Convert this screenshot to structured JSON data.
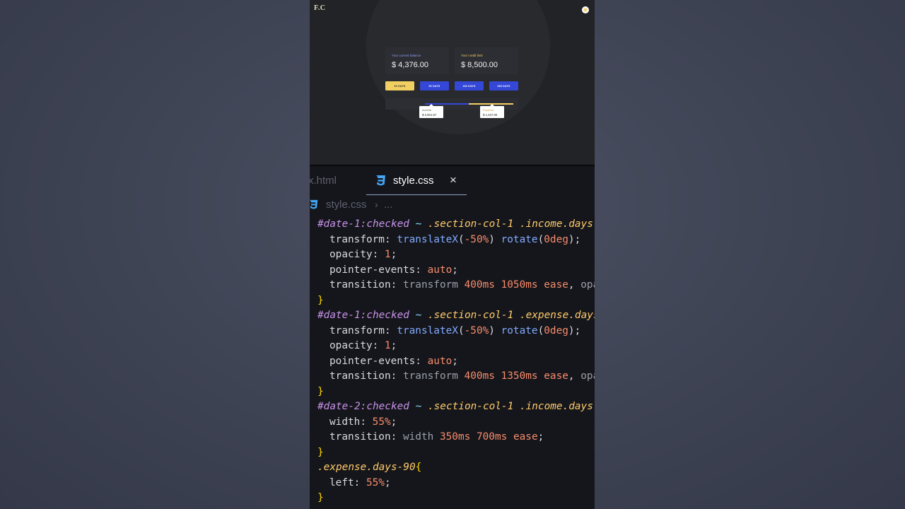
{
  "preview": {
    "logo": "F.C",
    "cards": {
      "balance": {
        "label": "Your current balance",
        "value": "$ 4,376.00"
      },
      "credit": {
        "label": "Your credit limit",
        "value": "$ 8,500.00"
      }
    },
    "range_buttons": [
      "30 DAYS",
      "90 DAYS",
      "180 DAYS",
      "365 DAYS"
    ],
    "selected_range": "30 DAYS",
    "tooltips": {
      "income": {
        "label": "Income",
        "value": "$ 2,501.57"
      },
      "expense": {
        "label": "Expense",
        "value": "$ 1,347.00"
      }
    },
    "colors": {
      "accent_yellow": "#f2cf61",
      "accent_blue": "#3447d6"
    }
  },
  "editor": {
    "tabs": {
      "inactive": "x.html",
      "active": "style.css",
      "close": "×"
    },
    "breadcrumb": {
      "file": "style.css",
      "separator": "›",
      "more": "..."
    },
    "icons": {
      "tab_file": "css3-icon",
      "breadcrumb_file": "css3-icon"
    },
    "code_lines": [
      [
        [
          "sel-id",
          "#date-1"
        ],
        [
          "pseudo",
          ":checked"
        ],
        [
          "comb",
          " ~ "
        ],
        [
          "cls",
          ".section-col-1"
        ],
        [
          "comb",
          " "
        ],
        [
          "cls",
          ".income.days-"
        ]
      ],
      [
        [
          "ind",
          ""
        ],
        [
          "prop",
          "transform"
        ],
        [
          "punc",
          ": "
        ],
        [
          "fn",
          "translateX"
        ],
        [
          "punc",
          "("
        ],
        [
          "num",
          "-50%"
        ],
        [
          "punc",
          ") "
        ],
        [
          "fn",
          "rotate"
        ],
        [
          "punc",
          "("
        ],
        [
          "num",
          "0deg"
        ],
        [
          "punc",
          ");"
        ]
      ],
      [
        [
          "ind",
          ""
        ],
        [
          "prop",
          "opacity"
        ],
        [
          "punc",
          ": "
        ],
        [
          "num",
          "1"
        ],
        [
          "punc",
          ";"
        ]
      ],
      [
        [
          "ind",
          ""
        ],
        [
          "prop",
          "pointer-events"
        ],
        [
          "punc",
          ": "
        ],
        [
          "kw",
          "auto"
        ],
        [
          "punc",
          ";"
        ]
      ],
      [
        [
          "ind",
          ""
        ],
        [
          "prop",
          "transition"
        ],
        [
          "punc",
          ": "
        ],
        [
          "ident",
          "transform "
        ],
        [
          "num",
          "400ms"
        ],
        [
          "punc",
          " "
        ],
        [
          "num",
          "1050ms"
        ],
        [
          "punc",
          " "
        ],
        [
          "kw",
          "ease"
        ],
        [
          "punc",
          ", "
        ],
        [
          "ident",
          "opa"
        ]
      ],
      [
        [
          "brace",
          "}"
        ]
      ],
      [
        [
          "sel-id",
          "#date-1"
        ],
        [
          "pseudo",
          ":checked"
        ],
        [
          "comb",
          " ~ "
        ],
        [
          "cls",
          ".section-col-1"
        ],
        [
          "comb",
          " "
        ],
        [
          "cls",
          ".expense.days"
        ]
      ],
      [
        [
          "ind",
          ""
        ],
        [
          "prop",
          "transform"
        ],
        [
          "punc",
          ": "
        ],
        [
          "fn",
          "translateX"
        ],
        [
          "punc",
          "("
        ],
        [
          "num",
          "-50%"
        ],
        [
          "punc",
          ") "
        ],
        [
          "fn",
          "rotate"
        ],
        [
          "punc",
          "("
        ],
        [
          "num",
          "0deg"
        ],
        [
          "punc",
          ");"
        ]
      ],
      [
        [
          "ind",
          ""
        ],
        [
          "prop",
          "opacity"
        ],
        [
          "punc",
          ": "
        ],
        [
          "num",
          "1"
        ],
        [
          "punc",
          ";"
        ]
      ],
      [
        [
          "ind",
          ""
        ],
        [
          "prop",
          "pointer-events"
        ],
        [
          "punc",
          ": "
        ],
        [
          "kw",
          "auto"
        ],
        [
          "punc",
          ";"
        ]
      ],
      [
        [
          "ind",
          ""
        ],
        [
          "prop",
          "transition"
        ],
        [
          "punc",
          ": "
        ],
        [
          "ident",
          "transform "
        ],
        [
          "num",
          "400ms"
        ],
        [
          "punc",
          " "
        ],
        [
          "num",
          "1350ms"
        ],
        [
          "punc",
          " "
        ],
        [
          "kw",
          "ease"
        ],
        [
          "punc",
          ", "
        ],
        [
          "ident",
          "opa"
        ]
      ],
      [
        [
          "brace",
          "}"
        ]
      ],
      [
        [
          "sel-id",
          "#date-2"
        ],
        [
          "pseudo",
          ":checked"
        ],
        [
          "comb",
          " ~ "
        ],
        [
          "cls",
          ".section-col-1"
        ],
        [
          "comb",
          " "
        ],
        [
          "cls",
          ".income.days-"
        ]
      ],
      [
        [
          "ind",
          ""
        ],
        [
          "prop",
          "width"
        ],
        [
          "punc",
          ": "
        ],
        [
          "num",
          "55%"
        ],
        [
          "punc",
          ";"
        ]
      ],
      [
        [
          "ind",
          ""
        ],
        [
          "prop",
          "transition"
        ],
        [
          "punc",
          ": "
        ],
        [
          "ident",
          "width "
        ],
        [
          "num",
          "350ms"
        ],
        [
          "punc",
          " "
        ],
        [
          "num",
          "700ms"
        ],
        [
          "punc",
          " "
        ],
        [
          "kw",
          "ease"
        ],
        [
          "punc",
          ";"
        ]
      ],
      [
        [
          "brace",
          "}"
        ]
      ],
      [
        [
          "cls",
          ".expense.days-90"
        ],
        [
          "brace",
          "{"
        ]
      ],
      [
        [
          "ind",
          ""
        ],
        [
          "prop",
          "left"
        ],
        [
          "punc",
          ": "
        ],
        [
          "num",
          "55%"
        ],
        [
          "punc",
          ";"
        ]
      ],
      [
        [
          "brace",
          "}"
        ]
      ]
    ]
  }
}
